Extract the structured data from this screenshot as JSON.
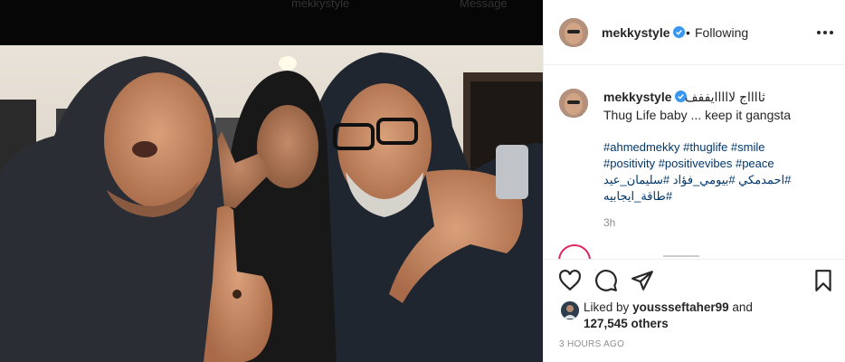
{
  "post": {
    "author": "mekkystyle",
    "follow_status": "Following",
    "dot": "•",
    "caption": {
      "author": "mekkystyle",
      "arabic_text": "ثااااج لااااايففف",
      "text": "Thug Life baby ... keep it gangsta",
      "hashtags_line1": "#ahmedmekky #thuglife #smile",
      "hashtags_line2": "#positivity #positivevibes #peace",
      "hashtags_line3": "#احمدمكي #بيومي_فؤاد #سليمان_عيد",
      "hashtags_line4": "#طاقة_ايجابيه",
      "time_ago": "3h"
    },
    "likes": {
      "prefix": "Liked by",
      "user": "youssseftaher99",
      "and": "and",
      "count": "127,545 others"
    },
    "date": "3 HOURS AGO"
  },
  "background_ghost_text": {
    "left": "",
    "center": "mekkystyle",
    "right": "Message"
  },
  "colors": {
    "verified_blue": "#3897f0",
    "hashtag_blue": "#00376b",
    "muted_gray": "#8e8e8e"
  },
  "icons": [
    "heart-icon",
    "comment-icon",
    "share-icon",
    "bookmark-icon",
    "more-icon",
    "verified-icon"
  ]
}
